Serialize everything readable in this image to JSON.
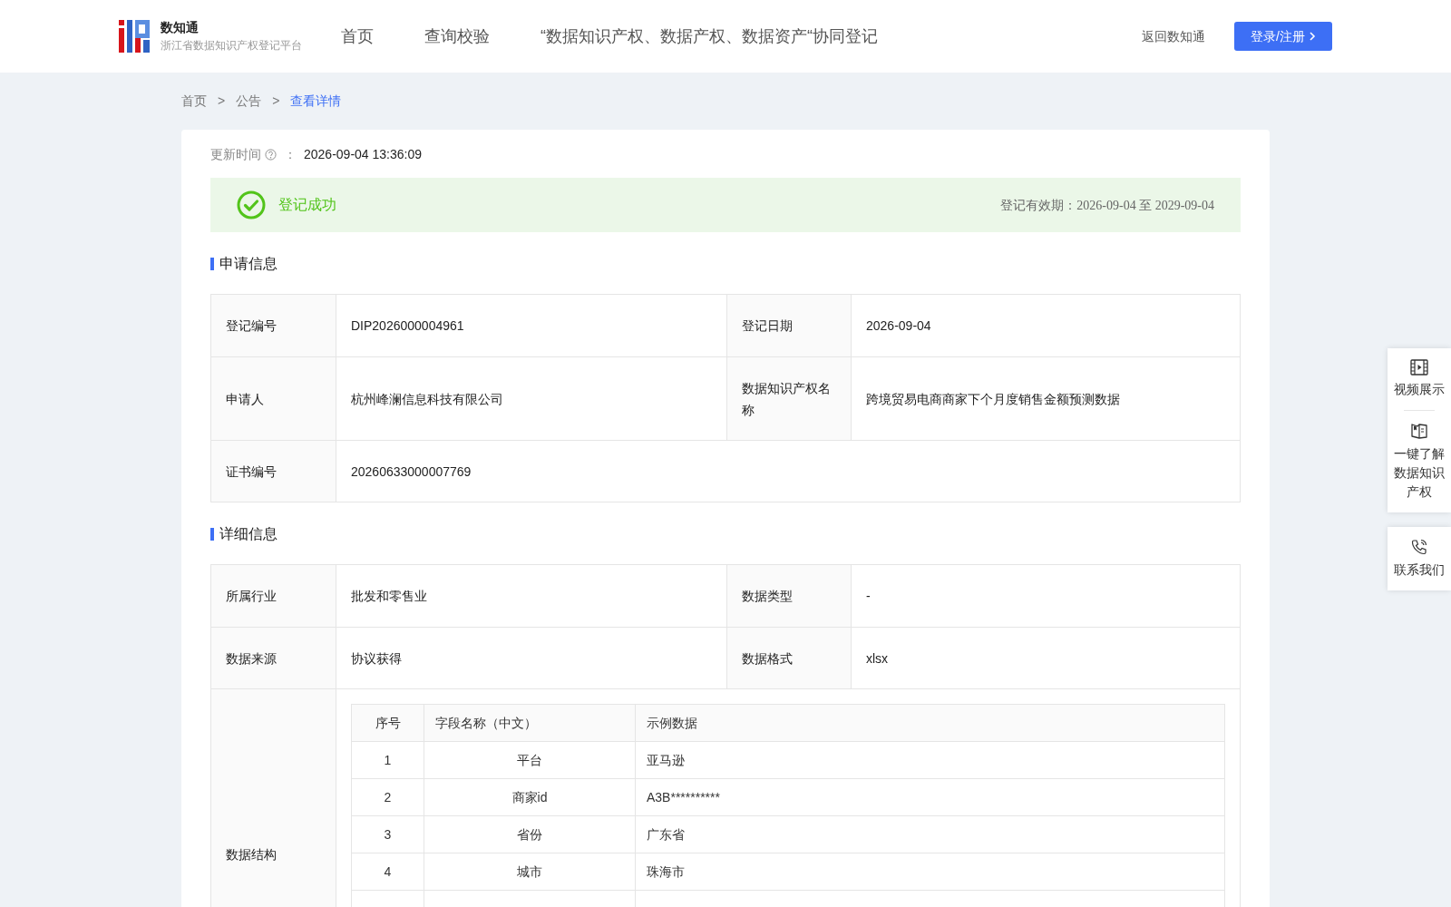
{
  "header": {
    "brand": {
      "name": "数知通",
      "subtitle": "浙江省数据知识产权登记平台"
    },
    "nav": [
      {
        "label": "首页",
        "selected": false
      },
      {
        "label": "查询校验",
        "selected": false
      },
      {
        "label": "“数据知识产权、数据产权、数据资产“协同登记",
        "selected": false
      }
    ],
    "back_link": "返回数知通",
    "login_button": "登录/注册"
  },
  "breadcrumb": [
    {
      "label": "首页",
      "current": false
    },
    {
      "label": "公告",
      "current": false
    },
    {
      "label": "查看详情",
      "current": true
    }
  ],
  "breadcrumb_separator": ">",
  "update_time": {
    "label": "更新时间",
    "separator": "：",
    "value": "2026-09-04 13:36:09"
  },
  "status_banner": {
    "succeeded": true,
    "text": "登记成功",
    "validity": "登记有效期：2026-09-04 至 2029-09-04"
  },
  "sections": [
    {
      "title": "申请信息",
      "rows": [
        [
          {
            "label": "登记编号",
            "value": "DIP2026000004961"
          },
          {
            "label": "登记日期",
            "value": "2026-09-04"
          }
        ],
        [
          {
            "label": "申请人",
            "value": "杭州峰澜信息科技有限公司"
          },
          {
            "label": "数据知识产权名称",
            "value": "跨境贸易电商商家下个月度销售金额预测数据"
          }
        ],
        [
          {
            "label": "证书编号",
            "value": "20260633000007769"
          }
        ]
      ]
    },
    {
      "title": "详细信息",
      "rows": [
        [
          {
            "label": "所属行业",
            "value": "批发和零售业"
          },
          {
            "label": "数据类型",
            "value": "-"
          }
        ],
        [
          {
            "label": "数据来源",
            "value": "协议获得"
          },
          {
            "label": "数据格式",
            "value": "xlsx"
          }
        ]
      ],
      "structure": {
        "label": "数据结构",
        "columns": [
          "序号",
          "字段名称（中文）",
          "示例数据"
        ],
        "rows": [
          [
            "1",
            "平台",
            "亚马逊"
          ],
          [
            "2",
            "商家id",
            "A3B**********"
          ],
          [
            "3",
            "省份",
            "广东省"
          ],
          [
            "4",
            "城市",
            "珠海市"
          ]
        ]
      }
    }
  ],
  "side_panel": [
    {
      "kind": "video",
      "label": "视频展示"
    },
    {
      "kind": "book",
      "label": "一键了解数据知识产权"
    },
    {
      "kind": "phone",
      "label": "联系我们"
    }
  ]
}
